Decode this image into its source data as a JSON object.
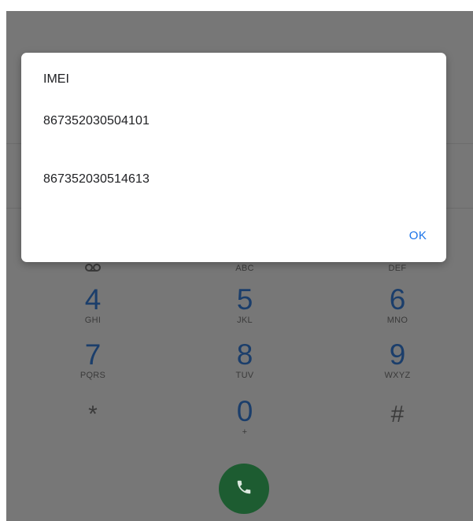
{
  "dialog": {
    "title": "IMEI",
    "imei_values": [
      "867352030504101",
      "867352030514613"
    ],
    "ok_label": "OK"
  },
  "dialpad": {
    "row1_letters": [
      "ABC",
      "DEF"
    ],
    "keys": [
      {
        "digit": "4",
        "letters": "GHI"
      },
      {
        "digit": "5",
        "letters": "JKL"
      },
      {
        "digit": "6",
        "letters": "MNO"
      },
      {
        "digit": "7",
        "letters": "PQRS"
      },
      {
        "digit": "8",
        "letters": "TUV"
      },
      {
        "digit": "9",
        "letters": "WXYZ"
      },
      {
        "digit": "*",
        "letters": ""
      },
      {
        "digit": "0",
        "letters": "+"
      },
      {
        "digit": "#",
        "letters": ""
      }
    ]
  },
  "colors": {
    "accent": "#1a73e8",
    "call_button": "#1d5c31",
    "scrim": "#777777",
    "digit": "#1b3e6b"
  },
  "icons": {
    "call": "phone-icon",
    "voicemail": "voicemail-icon"
  }
}
